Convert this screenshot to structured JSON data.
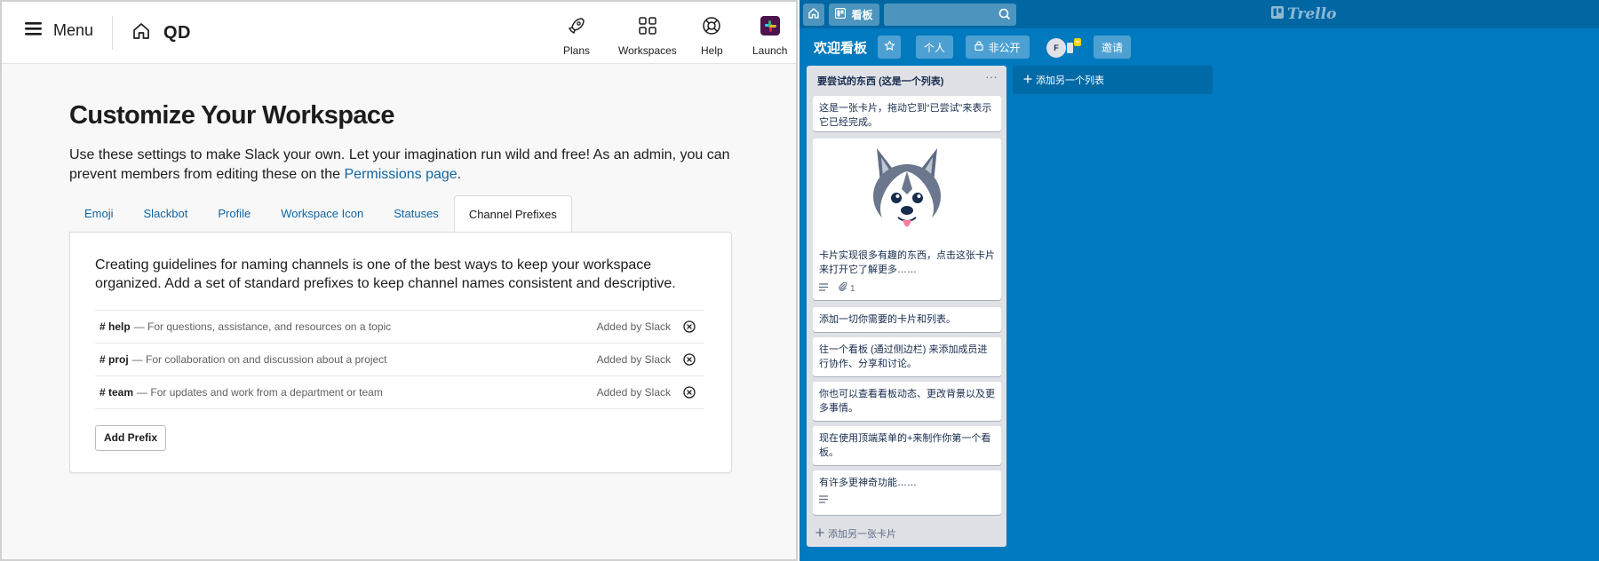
{
  "slack": {
    "topbar": {
      "menu_label": "Menu",
      "workspace_name": "QD",
      "nav": [
        {
          "label": "Plans",
          "icon": "rocket-icon"
        },
        {
          "label": "Workspaces",
          "icon": "grid-icon"
        },
        {
          "label": "Help",
          "icon": "lifebuoy-icon"
        },
        {
          "label": "Launch",
          "icon": "slack-logo-icon"
        }
      ]
    },
    "title": "Customize Your Workspace",
    "desc_text": "Use these settings to make Slack your own. Let your imagination run wild and free! As an admin, you can prevent members from editing these on the ",
    "desc_link": "Permissions page",
    "desc_end": ".",
    "tabs": [
      "Emoji",
      "Slackbot",
      "Profile",
      "Workspace Icon",
      "Statuses",
      "Channel Prefixes"
    ],
    "active_tab": "Channel Prefixes",
    "panel_text": "Creating guidelines for naming channels is one of the best ways to keep your workspace organized. Add a set of standard prefixes to keep channel names consistent and descriptive.",
    "prefixes": [
      {
        "name": "# help",
        "desc": "— For questions, assistance, and resources on a topic",
        "added": "Added by Slack"
      },
      {
        "name": "# proj",
        "desc": "— For collaboration on and discussion about a project",
        "added": "Added by Slack"
      },
      {
        "name": "# team",
        "desc": "— For updates and work from a department or team",
        "added": "Added by Slack"
      }
    ],
    "add_button": "Add Prefix",
    "colors": {
      "link": "#1264a3",
      "text": "#1d1c1d"
    }
  },
  "trello": {
    "header": {
      "boards_label": "看板",
      "search_placeholder": "",
      "logo_text": "Trello"
    },
    "board": {
      "name": "欢迎看板",
      "visibility_team": "个人",
      "visibility": "非公开",
      "avatar_initial": "F",
      "invite_label": "邀请"
    },
    "list": {
      "title": "要尝试的东西 (这是一个列表)",
      "menu": "···",
      "cards": [
        {
          "text": "这是一张卡片，拖动它到“已尝试”来表示它已经完成。"
        },
        {
          "text": "卡片实现很多有趣的东西，点击这张卡片来打开它了解更多……",
          "image": "husky-image",
          "attachments": "1"
        },
        {
          "text": "添加一切你需要的卡片和列表。"
        },
        {
          "text": "往一个看板 (通过侧边栏) 来添加成员进行协作、分享和讨论。"
        },
        {
          "text": "你也可以查看看板动态、更改背景以及更多事情。"
        },
        {
          "text": "现在使用顶端菜单的+来制作你第一个看板。"
        },
        {
          "text": "有许多更神奇功能……"
        }
      ],
      "add_card": "添加另一张卡片"
    },
    "add_list": "添加另一个列表",
    "colors": {
      "background": "#0179bf",
      "header": "#0067a3",
      "list": "#dfe1e6"
    }
  }
}
